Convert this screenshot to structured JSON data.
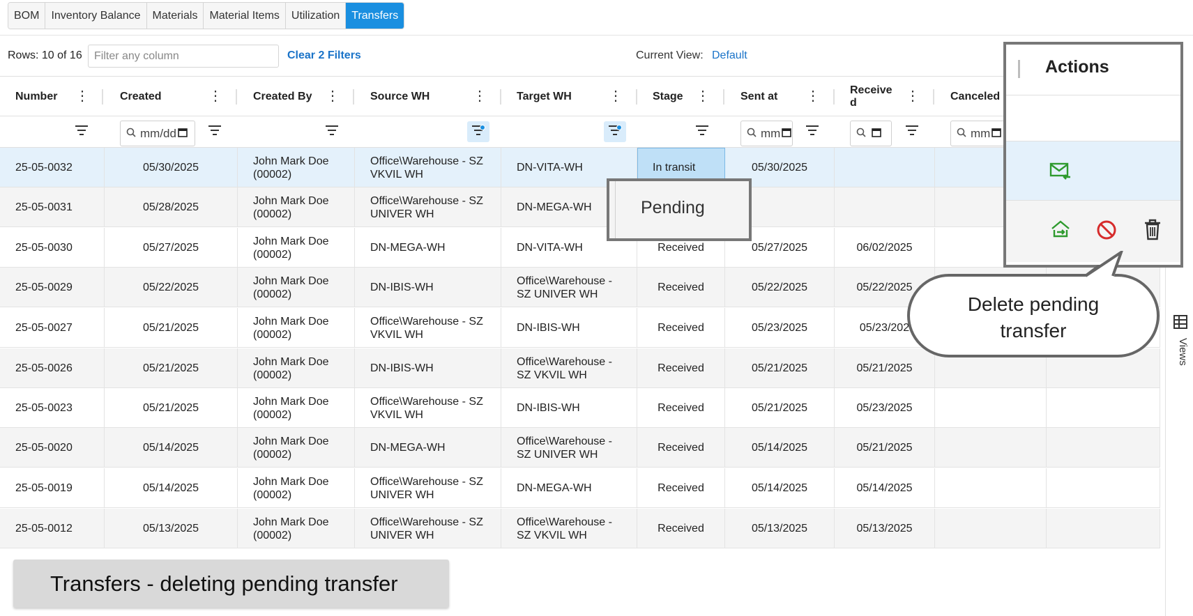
{
  "tabs": [
    {
      "label": "BOM",
      "active": false
    },
    {
      "label": "Inventory Balance",
      "active": false
    },
    {
      "label": "Materials",
      "active": false
    },
    {
      "label": "Material Items",
      "active": false
    },
    {
      "label": "Utilization",
      "active": false
    },
    {
      "label": "Transfers",
      "active": true
    }
  ],
  "toolbar": {
    "rows_text": "Rows: 10 of 16",
    "filter_placeholder": "Filter any column",
    "clear_filters": "Clear 2 Filters",
    "current_view_label": "Current View:",
    "current_view_value": "Default"
  },
  "columns": {
    "number": "Number",
    "created": "Created",
    "created_by": "Created By",
    "source_wh": "Source WH",
    "target_wh": "Target WH",
    "stage": "Stage",
    "sent_at": "Sent at",
    "received": "Receive\nd",
    "canceled": "Canceled"
  },
  "filters": {
    "created_date": "mm/dd",
    "sent_date": "mm",
    "received_date": "",
    "canceled_date": "mm"
  },
  "rows": [
    {
      "number": "25-05-0032",
      "created": "05/30/2025",
      "created_by": "John Mark Doe (00002)",
      "source": "Office\\Warehouse - SZ VKVIL WH",
      "target": "DN-VITA-WH",
      "stage": "In transit",
      "sent": "05/30/2025",
      "received": "",
      "canceled": ""
    },
    {
      "number": "25-05-0031",
      "created": "05/28/2025",
      "created_by": "John Mark Doe (00002)",
      "source": "Office\\Warehouse - SZ UNIVER WH",
      "target": "DN-MEGA-WH",
      "stage": "",
      "sent": "",
      "received": "",
      "canceled": ""
    },
    {
      "number": "25-05-0030",
      "created": "05/27/2025",
      "created_by": "John Mark Doe (00002)",
      "source": "DN-MEGA-WH",
      "target": "DN-VITA-WH",
      "stage": "Received",
      "sent": "05/27/2025",
      "received": "06/02/2025",
      "canceled": ""
    },
    {
      "number": "25-05-0029",
      "created": "05/22/2025",
      "created_by": "John Mark Doe (00002)",
      "source": "DN-IBIS-WH",
      "target": "Office\\Warehouse - SZ UNIVER WH",
      "stage": "Received",
      "sent": "05/22/2025",
      "received": "05/22/2025",
      "canceled": ""
    },
    {
      "number": "25-05-0027",
      "created": "05/21/2025",
      "created_by": "John Mark Doe (00002)",
      "source": "Office\\Warehouse - SZ VKVIL WH",
      "target": "DN-IBIS-WH",
      "stage": "Received",
      "sent": "05/23/2025",
      "received": "05/23/202",
      "canceled": ""
    },
    {
      "number": "25-05-0026",
      "created": "05/21/2025",
      "created_by": "John Mark Doe (00002)",
      "source": "DN-IBIS-WH",
      "target": "Office\\Warehouse - SZ VKVIL WH",
      "stage": "Received",
      "sent": "05/21/2025",
      "received": "05/21/2025",
      "canceled": ""
    },
    {
      "number": "25-05-0023",
      "created": "05/21/2025",
      "created_by": "John Mark Doe (00002)",
      "source": "Office\\Warehouse - SZ VKVIL WH",
      "target": "DN-IBIS-WH",
      "stage": "Received",
      "sent": "05/21/2025",
      "received": "05/23/2025",
      "canceled": ""
    },
    {
      "number": "25-05-0020",
      "created": "05/14/2025",
      "created_by": "John Mark Doe (00002)",
      "source": "DN-MEGA-WH",
      "target": "Office\\Warehouse - SZ UNIVER WH",
      "stage": "Received",
      "sent": "05/14/2025",
      "received": "05/21/2025",
      "canceled": ""
    },
    {
      "number": "25-05-0019",
      "created": "05/14/2025",
      "created_by": "John Mark Doe (00002)",
      "source": "Office\\Warehouse - SZ UNIVER WH",
      "target": "DN-MEGA-WH",
      "stage": "Received",
      "sent": "05/14/2025",
      "received": "05/14/2025",
      "canceled": ""
    },
    {
      "number": "25-05-0012",
      "created": "05/13/2025",
      "created_by": "John Mark Doe (00002)",
      "source": "Office\\Warehouse - SZ UNIVER WH",
      "target": "Office\\Warehouse - SZ VKVIL WH",
      "stage": "Received",
      "sent": "05/13/2025",
      "received": "05/13/2025",
      "canceled": ""
    }
  ],
  "actions_panel": {
    "title": "Actions",
    "row1_icons": [
      "receive-mail-icon"
    ],
    "row2_icons": [
      "send-transfer-icon",
      "cancel-icon",
      "trash-icon"
    ]
  },
  "pending_popup": {
    "text": "Pending"
  },
  "callout": {
    "line1": "Delete pending",
    "line2": "transfer"
  },
  "side": {
    "views_label": "Views"
  },
  "caption": "Transfers - deleting pending transfer",
  "colors": {
    "accent": "#1a8fe0",
    "link": "#1a73c8",
    "icon_green": "#2e9a2e",
    "icon_red": "#d62b2b"
  }
}
